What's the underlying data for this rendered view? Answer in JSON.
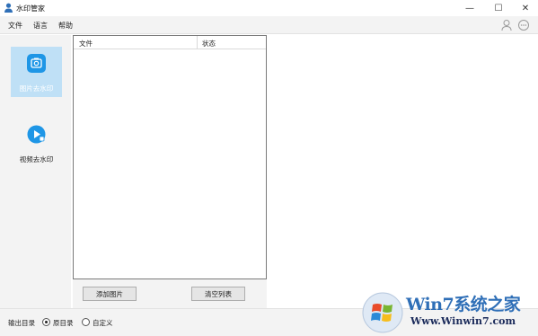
{
  "window": {
    "title": "水印管家",
    "minimize_glyph": "—",
    "maximize_glyph": "☐",
    "close_glyph": "✕"
  },
  "menu": {
    "items": [
      {
        "label": "文件"
      },
      {
        "label": "语言"
      },
      {
        "label": "帮助"
      }
    ],
    "right_icons": [
      "user-icon",
      "chat-icon"
    ]
  },
  "sidebar": {
    "items": [
      {
        "label": "图片去水印",
        "icon": "image-icon",
        "active": true
      },
      {
        "label": "视频去水印",
        "icon": "video-play-icon",
        "active": false
      }
    ]
  },
  "file_list": {
    "columns": [
      "文件",
      "状态"
    ],
    "rows": []
  },
  "actions": {
    "add_label": "添加图片",
    "clear_label": "清空列表"
  },
  "output": {
    "label": "输出目录",
    "options": [
      {
        "label": "原目录",
        "checked": true
      },
      {
        "label": "自定义",
        "checked": false
      }
    ]
  },
  "watermark": {
    "brand": "Win7系统之家",
    "url": "Www.Winwin7.com"
  },
  "colors": {
    "accent": "#1e96e6",
    "active_bg": "#bfe0f6",
    "panel_bg": "#f3f3f3"
  }
}
